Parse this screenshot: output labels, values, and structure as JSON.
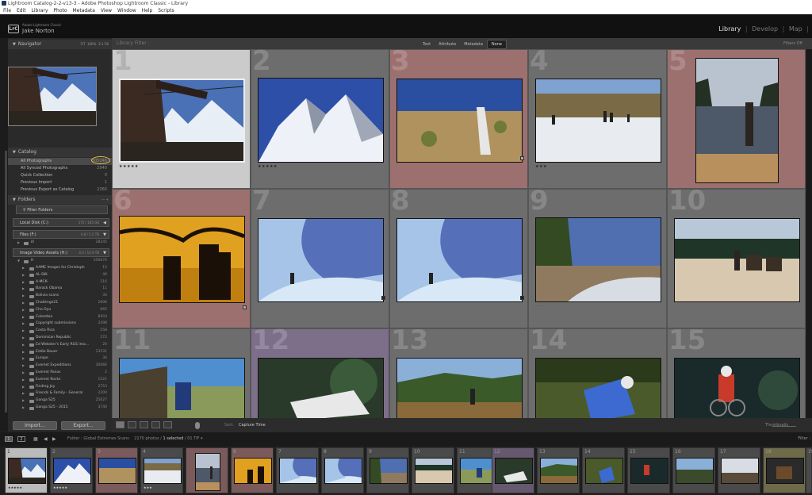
{
  "window": {
    "title": "Lightroom Catalog-2-2-v13-3 - Adobe Photoshop Lightroom Classic - Library"
  },
  "menu": [
    "File",
    "Edit",
    "Library",
    "Photo",
    "Metadata",
    "View",
    "Window",
    "Help",
    "Scripts"
  ],
  "identity": {
    "logo": "LrC",
    "app": "Adobe Lightroom Classic",
    "user": "Jake Norton"
  },
  "modules": {
    "library": "Library",
    "develop": "Develop",
    "map": "Map",
    "sep": "|"
  },
  "navigator": {
    "title": "Navigator",
    "zoom1": "FIT",
    "zoom2": "100%",
    "zoom3": "3:1 Fill"
  },
  "catalog": {
    "title": "Catalog",
    "items": [
      {
        "label": "All Photographs",
        "count": "305246"
      },
      {
        "label": "All Synced Photographs",
        "count": "2940"
      },
      {
        "label": "Quick Collection",
        "count": "0"
      },
      {
        "label": "Previous Import",
        "count": "1"
      },
      {
        "label": "Previous Export as Catalog",
        "count": "2260"
      }
    ]
  },
  "folders": {
    "title": "Folders",
    "filter": "Filter Folders",
    "volumes": [
      {
        "label": "Local Disk (C:)",
        "count": "175 / 185 GB"
      },
      {
        "label": "Files (F:)",
        "count": "4.8 / 5.5 TB"
      },
      {
        "label": "Image Video Assets (H:)",
        "count": "4.0 / 10.9 TB"
      }
    ],
    "f_sub": {
      "label": "ill",
      "count": "28245"
    },
    "h_root": {
      "label": "H",
      "count": "556670"
    },
    "items": [
      {
        "label": "AAME Images for Christoph",
        "count": "15"
      },
      {
        "label": "AL-SW-",
        "count": "46"
      },
      {
        "label": "A-MCK-",
        "count": "216"
      },
      {
        "label": "Barack Obama",
        "count": "11"
      },
      {
        "label": "Bolivia scans",
        "count": "34"
      },
      {
        "label": "Challenge21",
        "count": "1606"
      },
      {
        "label": "Cho Oyu",
        "count": "965"
      },
      {
        "label": "Colombia",
        "count": "8403"
      },
      {
        "label": "Copyright submissions",
        "count": "2498"
      },
      {
        "label": "Costa Rica",
        "count": "558"
      },
      {
        "label": "Dominican Republic",
        "count": "272"
      },
      {
        "label": "Ed Webster's Early RGS ima...",
        "count": "20"
      },
      {
        "label": "Eddie Bauer",
        "count": "13531"
      },
      {
        "label": "Europe",
        "count": "34"
      },
      {
        "label": "Everest Expeditions",
        "count": "30466"
      },
      {
        "label": "Everest Panos",
        "count": "2"
      },
      {
        "label": "Everest Rocks",
        "count": "1521"
      },
      {
        "label": "Finding Joy",
        "count": "2753"
      },
      {
        "label": "Friends & Family - General",
        "count": "2200"
      },
      {
        "label": "Ganga S25",
        "count": "25027"
      },
      {
        "label": "Ganga S25 - 2015",
        "count": "3740"
      }
    ]
  },
  "buttons": {
    "import": "Import...",
    "export": "Export..."
  },
  "filterbar": {
    "title": "Library Filter :",
    "tabs": [
      "Text",
      "Attribute",
      "Metadata",
      "None"
    ],
    "filters_off": "Filters Off"
  },
  "grid": {
    "numbers": [
      "1",
      "2",
      "3",
      "4",
      "5",
      "6",
      "7",
      "8",
      "9",
      "10",
      "11",
      "12",
      "13",
      "14",
      "15"
    ]
  },
  "toolbar": {
    "sort_label": "Sort:",
    "sort_value": "Capture Time",
    "thumbnails": "Thumbnails"
  },
  "filmbar": {
    "pages": [
      "1",
      "2"
    ],
    "folder_label": "Folder : Global Extremes Scans",
    "count_text": "2170 photos / ",
    "selected_text": "1 selected",
    "file_text": " / 01.TIF",
    "filter": "Filter :"
  },
  "filmstrip": {
    "numbers": [
      "1",
      "2",
      "3",
      "4",
      "5",
      "6",
      "7",
      "8",
      "9",
      "10",
      "11",
      "12",
      "13",
      "14",
      "15",
      "16",
      "17",
      "18",
      "19"
    ]
  },
  "stars": {
    "five": "★★★★★",
    "three": "★★★",
    "dots": "·····"
  }
}
